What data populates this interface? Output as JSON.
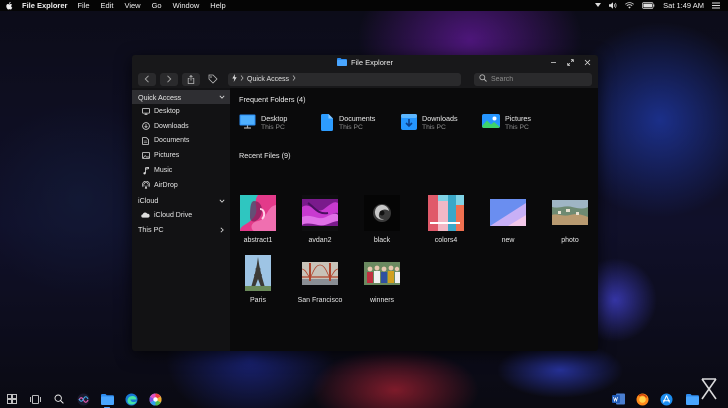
{
  "menubar": {
    "app_name": "File Explorer",
    "menus": [
      "File",
      "Edit",
      "View",
      "Go",
      "Window",
      "Help"
    ],
    "clock": "Sat 1:49 AM"
  },
  "window": {
    "title": "File Explorer",
    "address": "Quick Access",
    "search_placeholder": "Search"
  },
  "sidebar": {
    "quick_access": "Quick Access",
    "quick_items": [
      {
        "label": "Desktop",
        "icon": "desktop-icon"
      },
      {
        "label": "Downloads",
        "icon": "downloads-icon"
      },
      {
        "label": "Documents",
        "icon": "documents-icon"
      },
      {
        "label": "Pictures",
        "icon": "pictures-icon"
      },
      {
        "label": "Music",
        "icon": "music-icon"
      },
      {
        "label": "AirDrop",
        "icon": "airdrop-icon"
      }
    ],
    "icloud": "iCloud",
    "icloud_drive": "iCloud Drive",
    "this_pc": "This PC"
  },
  "main": {
    "frequent_title": "Frequent Folders (4)",
    "folders": [
      {
        "name": "Desktop",
        "sub": "This PC",
        "icon": "desktop-folder-icon"
      },
      {
        "name": "Documents",
        "sub": "This PC",
        "icon": "documents-folder-icon"
      },
      {
        "name": "Downloads",
        "sub": "This PC",
        "icon": "downloads-folder-icon"
      },
      {
        "name": "Pictures",
        "sub": "This PC",
        "icon": "pictures-folder-icon"
      }
    ],
    "recent_title": "Recent Files (9)",
    "files": [
      {
        "name": "abstract1"
      },
      {
        "name": "avdan2"
      },
      {
        "name": "black"
      },
      {
        "name": "colors4"
      },
      {
        "name": "new"
      },
      {
        "name": "photo"
      },
      {
        "name": "Paris"
      },
      {
        "name": "San Francisco"
      },
      {
        "name": "winners"
      }
    ]
  },
  "colors": {
    "accent": "#1e90ff",
    "window_bg": "#0e0e10",
    "sidebar_selected": "#2e2e32"
  }
}
